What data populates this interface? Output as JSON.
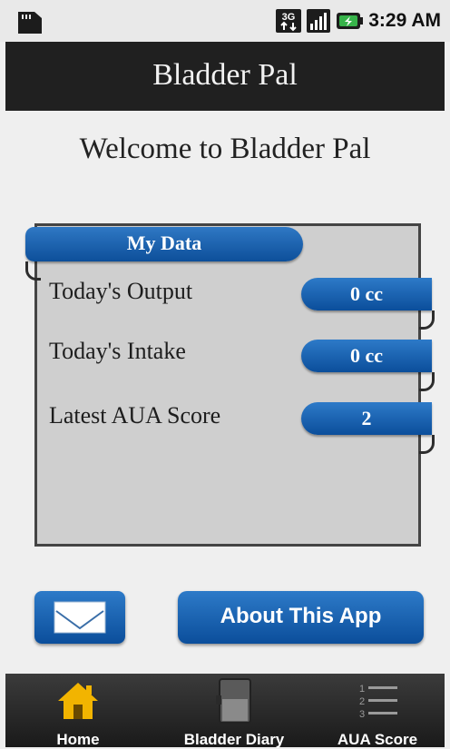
{
  "status_bar": {
    "time": "3:29 AM",
    "network_label": "3G",
    "icons": [
      "sd-card-icon",
      "3g-signal-icon",
      "signal-bars-icon",
      "battery-charging-icon"
    ]
  },
  "app": {
    "title": "Bladder Pal",
    "welcome": "Welcome to Bladder Pal"
  },
  "my_data": {
    "header": "My Data",
    "rows": [
      {
        "label": "Today's Output",
        "value": "0 cc"
      },
      {
        "label": "Today's Intake",
        "value": "0 cc"
      },
      {
        "label": "Latest AUA Score",
        "value": "2"
      }
    ]
  },
  "actions": {
    "email_icon": "envelope-icon",
    "about_label": "About This App"
  },
  "tabbar": {
    "items": [
      {
        "label": "Home",
        "icon": "home-icon"
      },
      {
        "label": "Bladder Diary",
        "icon": "diary-book-icon"
      },
      {
        "label": "AUA Score",
        "icon": "numbered-list-icon"
      }
    ]
  },
  "colors": {
    "accent_blue": "#0b4e9b",
    "title_bar": "#202020",
    "panel_bg": "#cfcfcf",
    "home_icon": "#f2b400"
  }
}
